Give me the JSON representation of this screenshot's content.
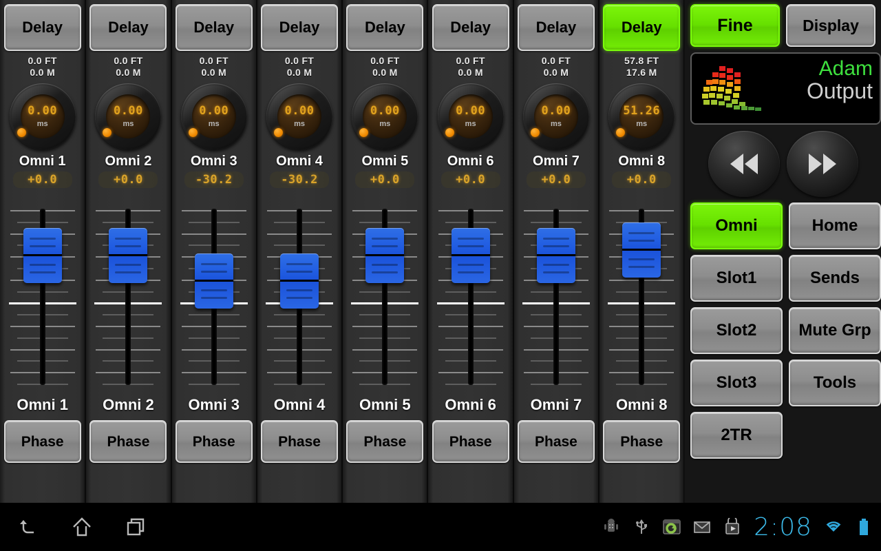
{
  "channels": [
    {
      "delay_label": "Delay",
      "delay_on": false,
      "dist_ft": "0.0 FT",
      "dist_m": "0.0 M",
      "knob_value": "0.00",
      "knob_unit": "ms",
      "name": "Omni 1",
      "gain": "+0.0",
      "fader_pct": 18,
      "phase_label": "Phase"
    },
    {
      "delay_label": "Delay",
      "delay_on": false,
      "dist_ft": "0.0 FT",
      "dist_m": "0.0 M",
      "knob_value": "0.00",
      "knob_unit": "ms",
      "name": "Omni 2",
      "gain": "+0.0",
      "fader_pct": 18,
      "phase_label": "Phase"
    },
    {
      "delay_label": "Delay",
      "delay_on": false,
      "dist_ft": "0.0 FT",
      "dist_m": "0.0 M",
      "knob_value": "0.00",
      "knob_unit": "ms",
      "name": "Omni 3",
      "gain": "-30.2",
      "fader_pct": 38,
      "phase_label": "Phase"
    },
    {
      "delay_label": "Delay",
      "delay_on": false,
      "dist_ft": "0.0 FT",
      "dist_m": "0.0 M",
      "knob_value": "0.00",
      "knob_unit": "ms",
      "name": "Omni 4",
      "gain": "-30.2",
      "fader_pct": 38,
      "phase_label": "Phase"
    },
    {
      "delay_label": "Delay",
      "delay_on": false,
      "dist_ft": "0.0 FT",
      "dist_m": "0.0 M",
      "knob_value": "0.00",
      "knob_unit": "ms",
      "name": "Omni 5",
      "gain": "+0.0",
      "fader_pct": 18,
      "phase_label": "Phase"
    },
    {
      "delay_label": "Delay",
      "delay_on": false,
      "dist_ft": "0.0 FT",
      "dist_m": "0.0 M",
      "knob_value": "0.00",
      "knob_unit": "ms",
      "name": "Omni 6",
      "gain": "+0.0",
      "fader_pct": 18,
      "phase_label": "Phase"
    },
    {
      "delay_label": "Delay",
      "delay_on": false,
      "dist_ft": "0.0 FT",
      "dist_m": "0.0 M",
      "knob_value": "0.00",
      "knob_unit": "ms",
      "name": "Omni 7",
      "gain": "+0.0",
      "fader_pct": 18,
      "phase_label": "Phase"
    },
    {
      "delay_label": "Delay",
      "delay_on": true,
      "dist_ft": "57.8 FT",
      "dist_m": "17.6 M",
      "knob_value": "51.26",
      "knob_unit": "ms",
      "name": "Omni 8",
      "gain": "+0.0",
      "fader_pct": 14,
      "phase_label": "Phase"
    }
  ],
  "right_panel": {
    "fine_label": "Fine",
    "fine_on": true,
    "display_label": "Display",
    "screen": {
      "user": "Adam",
      "mode": "Output",
      "logo": "led-meter-logo"
    },
    "transport": {
      "rewind": "rewind-icon",
      "forward": "fast-forward-icon"
    },
    "nav_buttons": [
      {
        "label": "Omni",
        "active": true
      },
      {
        "label": "Home",
        "active": false
      },
      {
        "label": "Slot1",
        "active": false
      },
      {
        "label": "Sends",
        "active": false
      },
      {
        "label": "Slot2",
        "active": false
      },
      {
        "label": "Mute Grp",
        "active": false
      },
      {
        "label": "Slot3",
        "active": false
      },
      {
        "label": "Tools",
        "active": false
      },
      {
        "label": "2TR",
        "active": false
      }
    ]
  },
  "android": {
    "nav": [
      {
        "icon": "back-icon"
      },
      {
        "icon": "home-icon"
      },
      {
        "icon": "recents-icon"
      }
    ],
    "status": [
      {
        "icon": "android-debug-icon"
      },
      {
        "icon": "usb-icon"
      },
      {
        "icon": "app-sync-icon"
      },
      {
        "icon": "gmail-icon"
      },
      {
        "icon": "play-store-icon"
      }
    ],
    "clock": "2:08",
    "wifi_icon": "wifi-icon",
    "battery_icon": "battery-icon"
  },
  "colors": {
    "active_green": "#66e000",
    "fader_blue": "#1f5ae0",
    "led_amber": "#d9a32a",
    "clock_cyan": "#3bb9e8",
    "screen_user_green": "#3ee03e"
  }
}
